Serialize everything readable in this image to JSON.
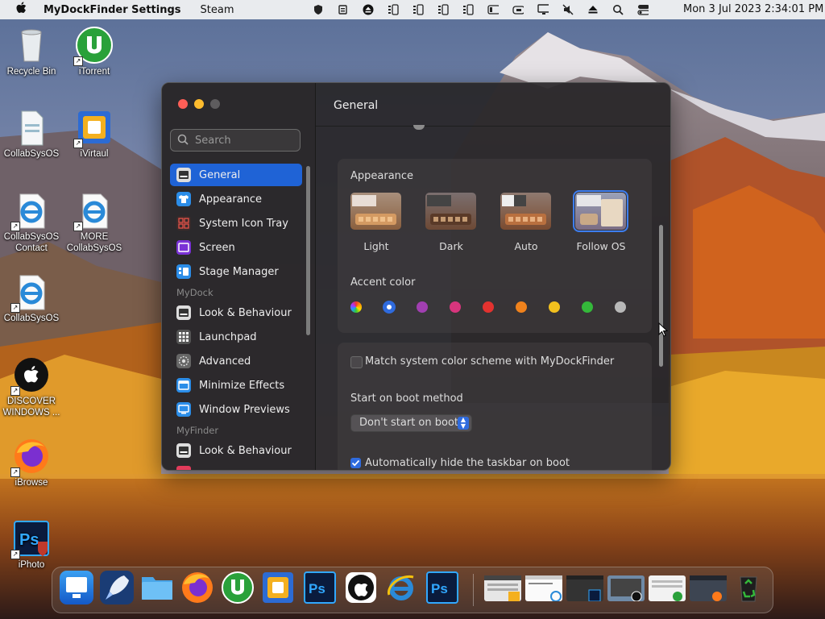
{
  "menubar": {
    "app_name": "MyDockFinder Settings",
    "menu_items": [
      "Steam"
    ],
    "clock": "Mon 3 Jul 2023  2:34:01 PM",
    "status_icons": [
      "shield-icon",
      "clipboard-icon",
      "eject-icon",
      "sliders-icon",
      "sliders-icon",
      "sliders-icon",
      "sliders-icon",
      "sidebar-icon",
      "cloud-icon",
      "monitor-icon",
      "mute-icon",
      "eject-icon",
      "search-icon",
      "toggle-icon"
    ]
  },
  "desktop": {
    "icons": [
      {
        "label": "Recycle Bin",
        "icon": "recycle-bin-icon"
      },
      {
        "label": "iTorrent",
        "icon": "utorrent-icon"
      },
      {
        "label": "CollabSysOS",
        "icon": "file-icon"
      },
      {
        "label": "iVirtaul",
        "icon": "virtual-box-icon"
      },
      {
        "label": "CollabSysOS Contact",
        "icon": "ie-icon"
      },
      {
        "label": "MORE CollabSysOS",
        "icon": "ie-icon"
      },
      {
        "label": "CollabSysOS",
        "icon": "ie-icon"
      },
      {
        "label": "DISCOVER WINDOWS ...",
        "icon": "apple-icon"
      },
      {
        "label": "iBrowse",
        "icon": "firefox-icon"
      },
      {
        "label": "iPhoto",
        "icon": "photoshop-icon"
      }
    ]
  },
  "window": {
    "title": "General",
    "search": {
      "placeholder": "Search"
    },
    "nav": {
      "items": [
        {
          "label": "General",
          "icon": "general-icon",
          "active": true
        },
        {
          "label": "Appearance",
          "icon": "tshirt-icon"
        },
        {
          "label": "System Icon Tray",
          "icon": "grid-icon"
        },
        {
          "label": "Screen",
          "icon": "screen-icon"
        },
        {
          "label": "Stage Manager",
          "icon": "stage-manager-icon"
        },
        {
          "label": "Look & Behaviour",
          "icon": "dock-icon"
        },
        {
          "label": "Launchpad",
          "icon": "launchpad-icon"
        },
        {
          "label": "Advanced",
          "icon": "gear-icon"
        },
        {
          "label": "Minimize Effects",
          "icon": "minimize-icon"
        },
        {
          "label": "Window Previews",
          "icon": "preview-icon"
        },
        {
          "label": "Look & Behaviour",
          "icon": "finder-icon"
        }
      ],
      "sections": [
        "MyDock",
        "MyFinder"
      ]
    },
    "appearance": {
      "label": "Appearance",
      "options": [
        "Light",
        "Dark",
        "Auto",
        "Follow OS"
      ],
      "selected": "Follow OS"
    },
    "accent": {
      "label": "Accent color",
      "colors": [
        "#multicolor",
        "#2f6bde",
        "#a13fb1",
        "#d8357d",
        "#e3322f",
        "#f0821c",
        "#f2c01e",
        "#34b83a",
        "#b8b8b8"
      ],
      "selected_index": 1
    },
    "match_scheme": {
      "label": "Match system color scheme with MyDockFinder",
      "checked": false
    },
    "boot": {
      "label": "Start on boot method",
      "value": "Don't start on boot"
    },
    "auto_hide": {
      "label": "Automatically hide the taskbar on boot",
      "checked": true
    }
  },
  "dock": {
    "apps": [
      "finder-icon",
      "launchpad-icon",
      "folder-icon",
      "firefox-icon",
      "utorrent-icon",
      "virtual-box-icon",
      "photoshop-icon",
      "apple-icon",
      "ie-icon",
      "photoshop-icon"
    ],
    "windows": [
      "explorer-window",
      "ie-window",
      "photoshop-window",
      "settings-window",
      "utorrent-window",
      "firefox-window"
    ],
    "trash": "recycle-icon"
  }
}
